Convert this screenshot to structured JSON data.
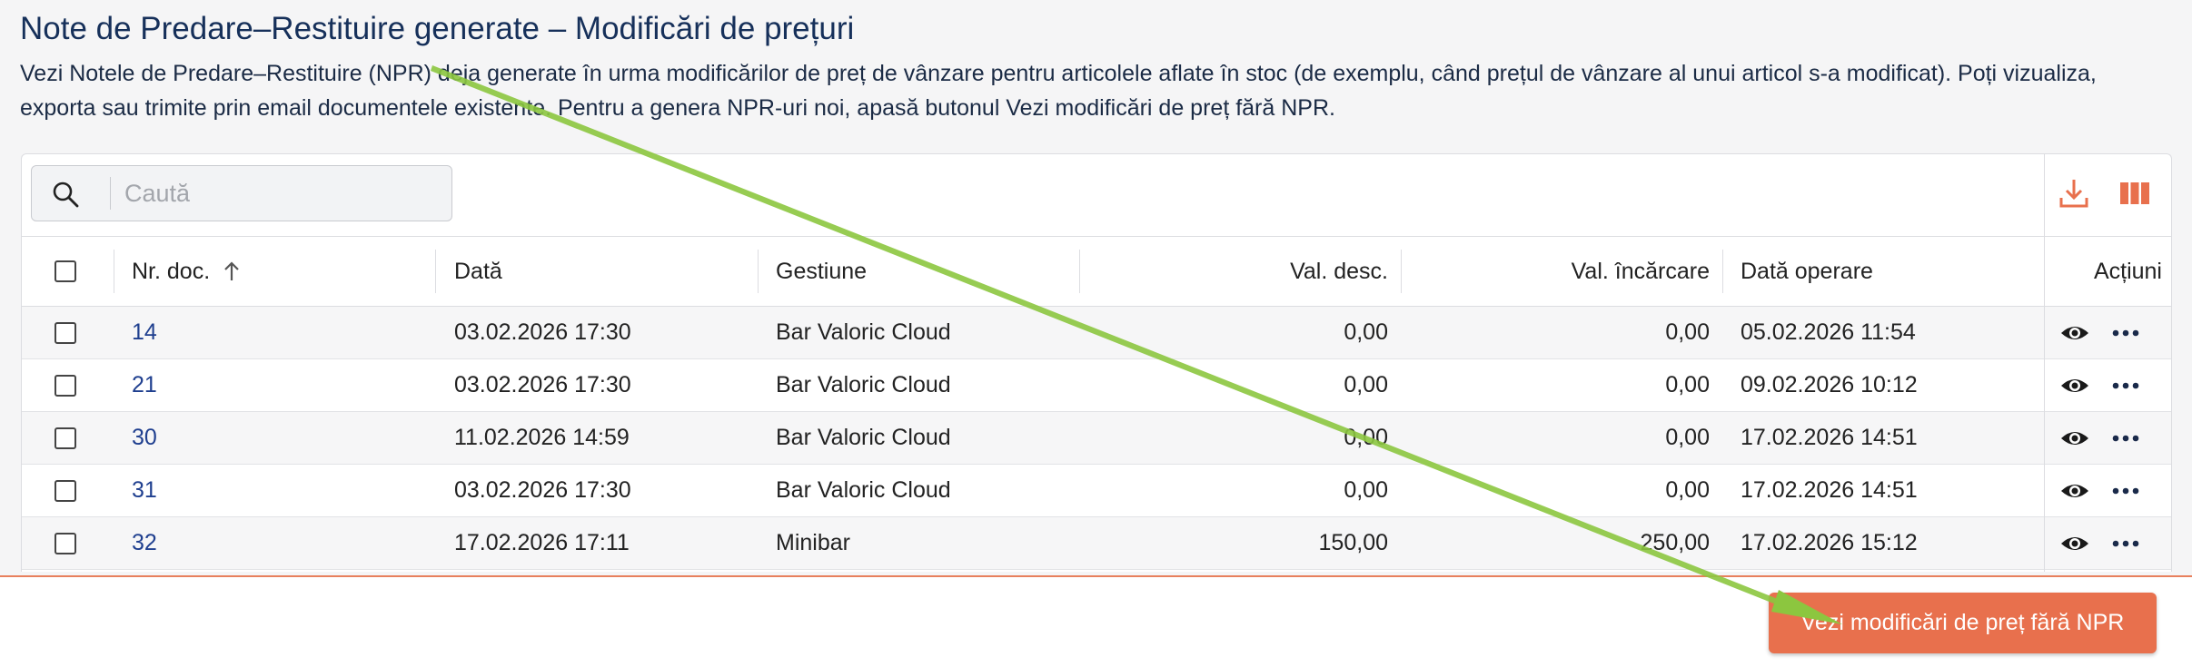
{
  "page": {
    "title": "Note de Predare–Restituire generate – Modificări de prețuri",
    "description": "Vezi Notele de Predare–Restituire (NPR) deja generate în urma modificărilor de preț de vânzare pentru articolele aflate în stoc (de exemplu, când prețul de vânzare al unui articol s-a modificat). Poți vizualiza, exporta sau trimite prin email documentele existente. Pentru a genera NPR-uri noi, apasă butonul Vezi modificări de preț fără NPR."
  },
  "search": {
    "placeholder": "Caută",
    "icon": "search-icon"
  },
  "toolbar": {
    "download_icon": "download-icon",
    "columns_icon": "columns-icon",
    "accent": "#e8704d"
  },
  "table": {
    "headers": {
      "nr_doc": "Nr. doc.",
      "data": "Dată",
      "gestiune": "Gestiune",
      "val_desc": "Val. desc.",
      "val_incarcare": "Val. încărcare",
      "data_operare": "Dată operare",
      "actiuni": "Acțiuni"
    },
    "sort": {
      "column": "nr_doc",
      "direction": "ascending"
    },
    "rows": [
      {
        "nr_doc": "14",
        "data": "03.02.2026 17:30",
        "gestiune": "Bar Valoric Cloud",
        "val_desc": "0,00",
        "val_incarcare": "0,00",
        "data_operare": "05.02.2026 11:54"
      },
      {
        "nr_doc": "21",
        "data": "03.02.2026 17:30",
        "gestiune": "Bar Valoric Cloud",
        "val_desc": "0,00",
        "val_incarcare": "0,00",
        "data_operare": "09.02.2026 10:12"
      },
      {
        "nr_doc": "30",
        "data": "11.02.2026 14:59",
        "gestiune": "Bar Valoric Cloud",
        "val_desc": "0,00",
        "val_incarcare": "0,00",
        "data_operare": "17.02.2026 14:51"
      },
      {
        "nr_doc": "31",
        "data": "03.02.2026 17:30",
        "gestiune": "Bar Valoric Cloud",
        "val_desc": "0,00",
        "val_incarcare": "0,00",
        "data_operare": "17.02.2026 14:51"
      },
      {
        "nr_doc": "32",
        "data": "17.02.2026 17:11",
        "gestiune": "Minibar",
        "val_desc": "150,00",
        "val_incarcare": "250,00",
        "data_operare": "17.02.2026 15:12"
      }
    ]
  },
  "footer": {
    "cta_label": "Vezi modificări de preț fără NPR"
  },
  "annotation": {
    "arrow_color": "#8cc63f"
  }
}
